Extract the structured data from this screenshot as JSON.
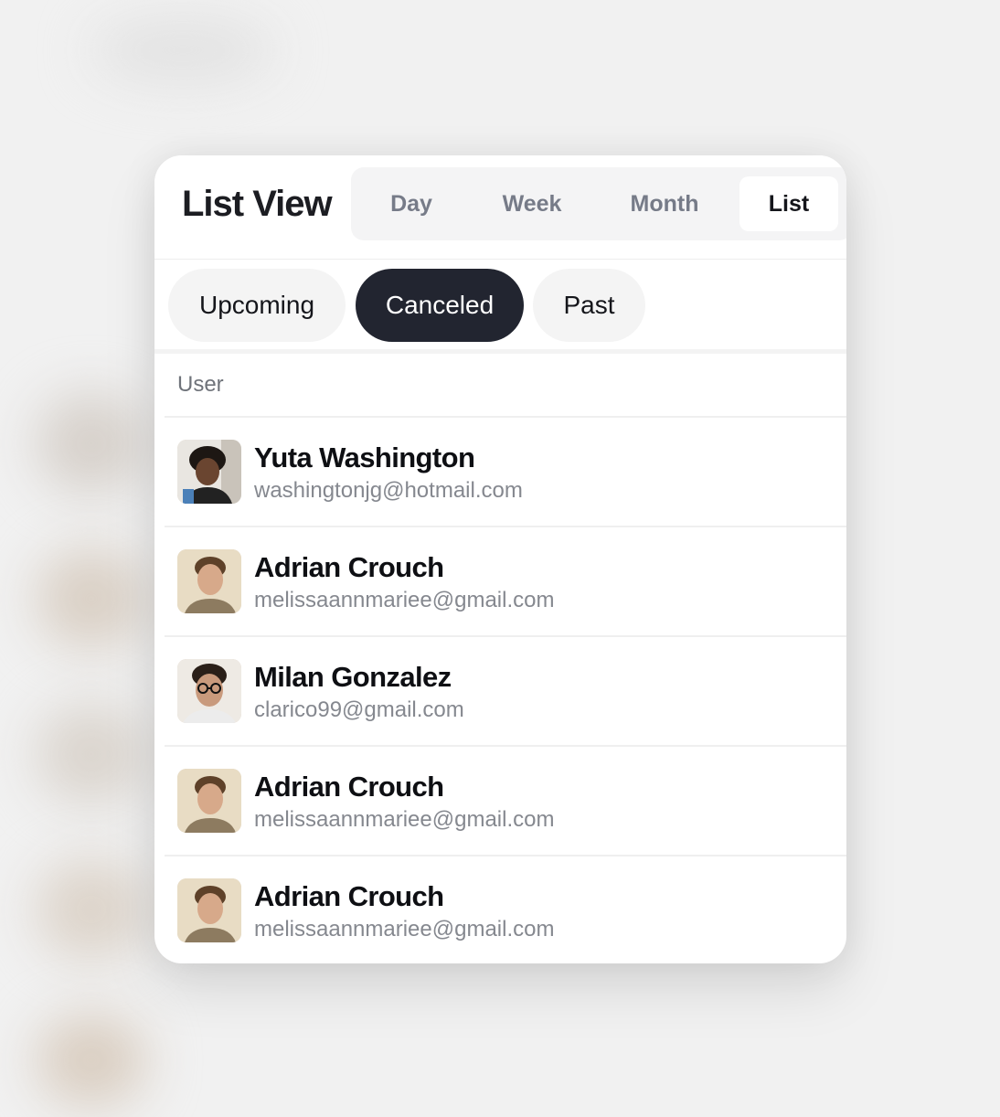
{
  "header": {
    "title": "List View",
    "view_tabs": [
      {
        "label": "Day",
        "active": false
      },
      {
        "label": "Week",
        "active": false
      },
      {
        "label": "Month",
        "active": false
      },
      {
        "label": "List",
        "active": true
      }
    ]
  },
  "filters": [
    {
      "label": "Upcoming",
      "active": false
    },
    {
      "label": "Canceled",
      "active": true
    },
    {
      "label": "Past",
      "active": false
    }
  ],
  "table": {
    "column_header": "User",
    "rows": [
      {
        "name": "Yuta Washington",
        "email": "washingtonjg@hotmail.com",
        "avatar": "person-photo"
      },
      {
        "name": "Adrian Crouch",
        "email": "melissaannmariee@gmail.com",
        "avatar": "person-photo"
      },
      {
        "name": "Milan Gonzalez",
        "email": "clarico99@gmail.com",
        "avatar": "person-photo"
      },
      {
        "name": "Adrian Crouch",
        "email": "melissaannmariee@gmail.com",
        "avatar": "person-photo"
      },
      {
        "name": "Adrian Crouch",
        "email": "melissaannmariee@gmail.com",
        "avatar": "person-photo"
      }
    ]
  },
  "colors": {
    "active_pill": "#222530",
    "inactive_pill": "#f4f4f4",
    "active_view_tab_text": "#15161b",
    "inactive_view_tab_text": "#767b88",
    "email_text": "#85888f"
  }
}
